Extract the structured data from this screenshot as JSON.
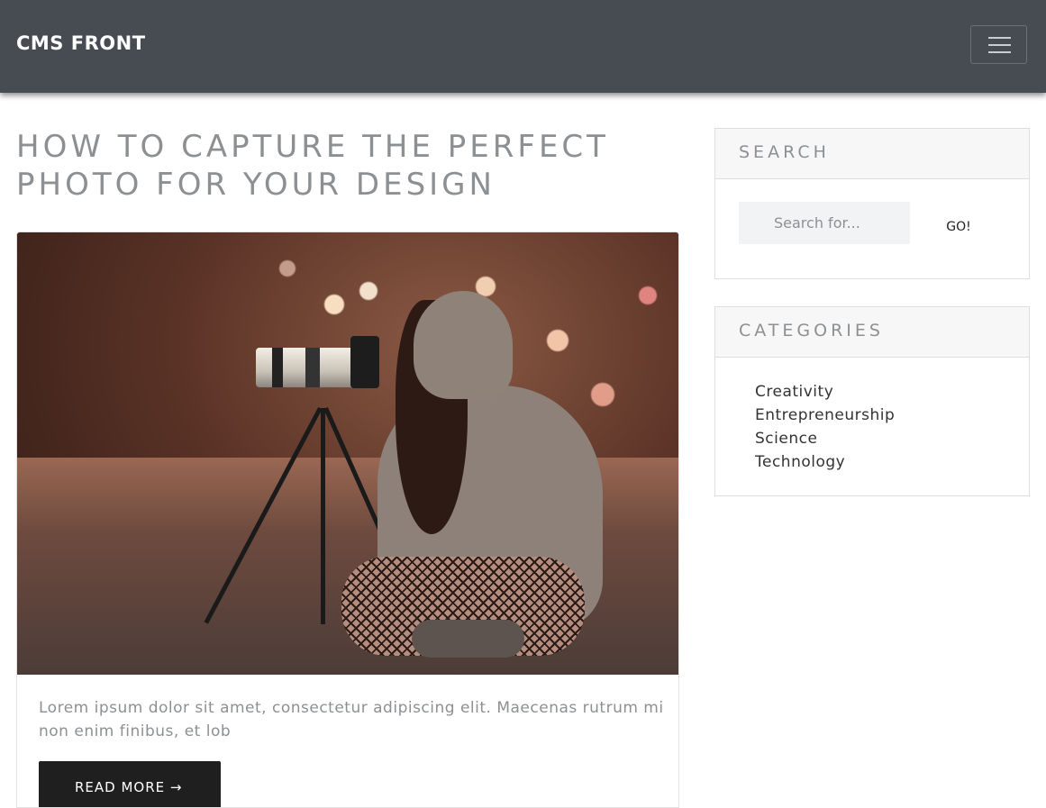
{
  "navbar": {
    "brand": "CMS FRONT",
    "toggle_icon": "hamburger-menu-icon"
  },
  "post": {
    "title": "HOW TO CAPTURE THE PERFECT PHOTO FOR YOUR DESIGN",
    "image_subject": "photographer-with-tripod-camera-image",
    "excerpt": "Lorem ipsum dolor sit amet, consectetur adipiscing elit. Maecenas rutrum mi non enim finibus, et lob",
    "read_more_label": "READ MORE →"
  },
  "sidebar": {
    "search": {
      "heading": "SEARCH",
      "placeholder": "Search for...",
      "button_label": "GO!"
    },
    "categories": {
      "heading": "CATEGORIES",
      "items": [
        {
          "label": "Creativity"
        },
        {
          "label": "Entrepreneurship"
        },
        {
          "label": "Science"
        },
        {
          "label": "Technology"
        }
      ]
    }
  },
  "colors": {
    "navbar_bg": "#474c53",
    "title_text": "#8d9093",
    "button_bg": "#1f1f1f"
  }
}
